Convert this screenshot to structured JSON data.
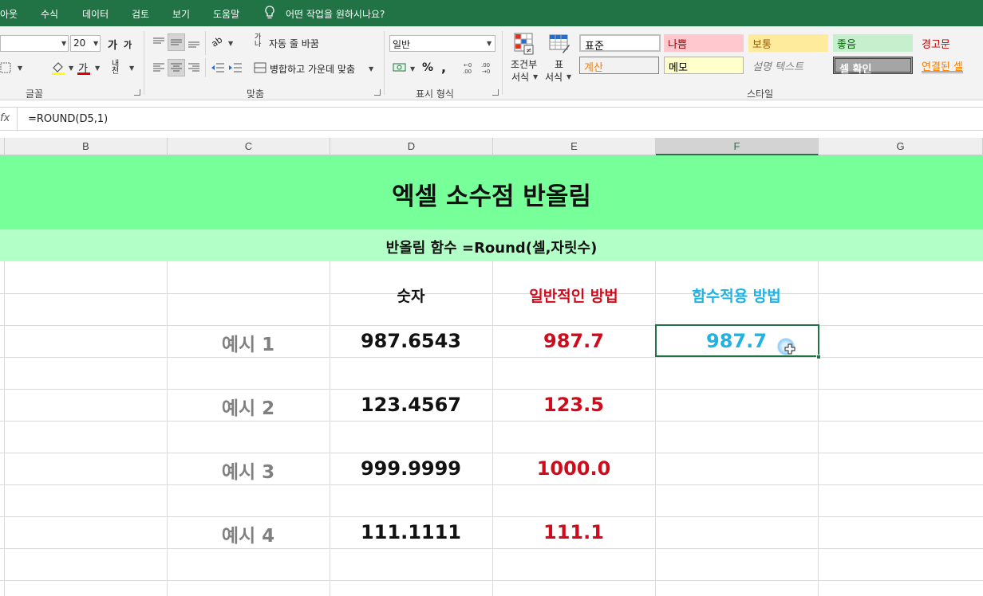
{
  "menu": {
    "items": [
      "아웃",
      "수식",
      "데이터",
      "검토",
      "보기",
      "도움말"
    ],
    "tell_me": "어떤 작업을 원하시나요?"
  },
  "ribbon": {
    "font_size": "20",
    "grow_font": "가",
    "shrink_font": "가",
    "font_color_glyph": "가",
    "phonetic": "내천",
    "wrap_text": "자동 줄 바꿈",
    "wrap_glyph": "가나",
    "orient_glyph": "ab",
    "merge_center": "병합하고 가운데 맞춤",
    "number_format": "일반",
    "percent": "%",
    "comma": ",",
    "cond_format": [
      "조건부",
      "서식"
    ],
    "format_table": [
      "표",
      "서식"
    ],
    "groups": {
      "font": "글꼴",
      "align": "맞춤",
      "number": "표시 형식",
      "styles": "스타일"
    },
    "styles": [
      {
        "label": "표준",
        "color": "#000000",
        "bg": "#ffffff"
      },
      {
        "label": "나쁨",
        "color": "#9c0006",
        "bg": "#ffc7ce"
      },
      {
        "label": "보통",
        "color": "#9c5700",
        "bg": "#ffeb9c"
      },
      {
        "label": "좋음",
        "color": "#006100",
        "bg": "#c6efce"
      },
      {
        "label": "경고문",
        "color": "#c00000",
        "bg": "#f3f3f3"
      },
      {
        "label": "계산",
        "color": "#fa7d00",
        "bg": "#f2f2f2"
      },
      {
        "label": "메모",
        "color": "#000000",
        "bg": "#ffffcc"
      },
      {
        "label": "설명 텍스트",
        "color": "#7f7f7f",
        "bg": "#f3f3f3"
      },
      {
        "label": "셀 확인",
        "color": "#ffffff",
        "bg": "#a5a5a5"
      },
      {
        "label": "연결된 셀",
        "color": "#fa7d00",
        "bg": "#f3f3f3"
      }
    ]
  },
  "formula_bar": {
    "fx": "fx",
    "formula": "=ROUND(D5,1)"
  },
  "columns": [
    "B",
    "C",
    "D",
    "E",
    "F",
    "G"
  ],
  "active_column": "F",
  "sheet": {
    "title": "엑셀 소수점 반올림",
    "subtitle": "반올림 함수 =Round(셀,자릿수)",
    "headers": {
      "number": "숫자",
      "normal": "일반적인 방법",
      "func": "함수적용 방법"
    },
    "rows": [
      {
        "label": "예시 1",
        "number": "987.6543",
        "normal": "987.7",
        "func": "987.7"
      },
      {
        "label": "예시 2",
        "number": "123.4567",
        "normal": "123.5",
        "func": ""
      },
      {
        "label": "예시 3",
        "number": "999.9999",
        "normal": "1000.0",
        "func": ""
      },
      {
        "label": "예시 4",
        "number": "111.1111",
        "normal": "111.1",
        "func": ""
      }
    ]
  }
}
